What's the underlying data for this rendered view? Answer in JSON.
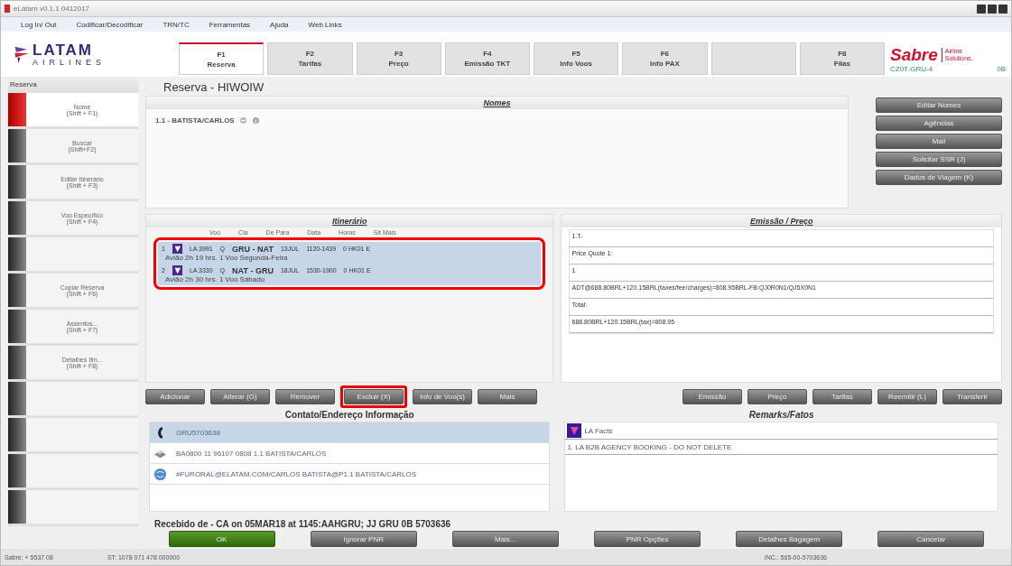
{
  "window": {
    "title": "eLatam v0.1.1 0412017"
  },
  "menu": [
    "Log In/ Out",
    "Codificar/Decodificar",
    "TRN/TC",
    "Ferramentas",
    "Ajuda",
    "Web Links"
  ],
  "logo": {
    "name": "LATAM",
    "sub": "AIRLINES"
  },
  "tabs": [
    {
      "key": "F1",
      "label": "Reserva",
      "selected": true
    },
    {
      "key": "F2",
      "label": "Tarifas",
      "selected": false
    },
    {
      "key": "F3",
      "label": "Preço",
      "selected": false
    },
    {
      "key": "F4",
      "label": "Emissão TKT",
      "selected": false
    },
    {
      "key": "F5",
      "label": "Info Voos",
      "selected": false
    },
    {
      "key": "F6",
      "label": "Info PAX",
      "selected": false
    },
    {
      "selected": false
    },
    {
      "key": "F8",
      "label": "Filas",
      "selected": false
    }
  ],
  "sabre": {
    "brand": "Sabre",
    "tagline": "Airline Solutions.",
    "code": "CZ0T-GRU-4",
    "extra": "0B"
  },
  "sidebar": {
    "title": "Reserva",
    "items": [
      {
        "label": "Nome",
        "shortcut": "(Shift + F1)",
        "selected": true
      },
      {
        "label": "Buscar",
        "shortcut": "(Shift+F2)",
        "selected": false
      },
      {
        "label": "Editar Itinerário",
        "shortcut": "(Shift + F3)",
        "selected": false
      },
      {
        "label": "Voo Específico",
        "shortcut": "(Shift + F4)",
        "selected": false
      },
      {
        "selected": false
      },
      {
        "label": "Copiar Reserva",
        "shortcut": "(Shift + F6)",
        "selected": false
      },
      {
        "label": "Assentos...",
        "shortcut": "(Shift + F7)",
        "selected": false
      },
      {
        "label": "Detalhes Itin...",
        "shortcut": "(Shift + F8)",
        "selected": false
      },
      {
        "selected": false
      },
      {
        "selected": false
      },
      {
        "selected": false
      },
      {
        "selected": false
      }
    ]
  },
  "reservation_title": "Reserva - HIWOIW",
  "names": {
    "title": "Nomes",
    "entries": [
      "1.1 - BATISTA/CARLOS"
    ]
  },
  "side_buttons": [
    "Editar Nomes",
    "Agências",
    "Mail",
    "Solicitar SSR (J)",
    "Dados de Viagem (K)"
  ],
  "itinerary": {
    "title": "Itinerário",
    "annotated": true,
    "columns": [
      "Voo",
      "Cia",
      "De Para",
      "Data",
      "Horas",
      "Sit Mais"
    ],
    "segments": [
      {
        "number": "1",
        "flight": "LA 3991",
        "class": "Q",
        "route": "GRU - NAT",
        "date": "13JUL",
        "time": "1120-1439",
        "status": "0 HK01 E",
        "detail": "Avião 2h 19 hrs. 1 Voo Segunda-Feira",
        "selected": true
      },
      {
        "number": "2",
        "flight": "LA 3330",
        "class": "Q",
        "route": "NAT - GRU",
        "date": "18JUL",
        "time": "1530-1900",
        "status": "0 HK01 E",
        "detail": "Avião 2h 30 hrs. 1 Voo Sábado",
        "selected": true
      }
    ]
  },
  "action_buttons": [
    {
      "label": "Adicionar",
      "highlighted": false
    },
    {
      "label": "Alterar (G)",
      "highlighted": false
    },
    {
      "label": "Remover",
      "highlighted": false
    },
    {
      "label": "Excluir (X)",
      "highlighted": true
    },
    {
      "label": "Info de Voo(s)",
      "highlighted": false
    },
    {
      "label": "Mais",
      "highlighted": false
    },
    {
      "label": "Emissão",
      "highlighted": false
    },
    {
      "label": "Preço",
      "highlighted": false
    },
    {
      "label": "Tarifas",
      "highlighted": false
    },
    {
      "label": "Reemitir (L)",
      "highlighted": false
    },
    {
      "label": "Transferir",
      "highlighted": false
    }
  ],
  "pricing": {
    "title": "Emissão / Preço",
    "lines": [
      "1.T-",
      "Price Quote 1:",
      "1",
      "ADT@688.80BRL+120.15BRL(taxes/fee/charges)=808.95BRL-FB:QJ0R0N1/QJ5X0N1",
      "Total:",
      "688.80BRL+120.15BRL(tax)=808.95"
    ]
  },
  "contacts": {
    "title": "Contato/Endereço Informação",
    "entries": [
      {
        "kind": "phone",
        "text": "GRU5703638",
        "selected": true
      },
      {
        "kind": "printer",
        "text": "BA0800 11 96107 0808 1.1 BATISTA/CARLOS",
        "selected": false
      },
      {
        "kind": "email",
        "text": "#FURORAL@ELATAM.COM/CARLOS BATISTA@P1.1 BATISTA/CARLOS",
        "selected": false
      }
    ]
  },
  "remarks": {
    "title": "Remarks/Fatos",
    "entries": [
      {
        "kind": "facts",
        "text": "LA Facts"
      },
      {
        "kind": "line",
        "text": "1. LA B2B AGENCY BOOKING - DO NOT DELETE"
      }
    ]
  },
  "received": "Recebido de - CA on 05MAR18 at 1145:AAHGRU; JJ GRU 0B 5703636",
  "bottom_buttons": [
    {
      "label": "OK",
      "kind": "primary"
    },
    {
      "label": "Ignorar PNR",
      "kind": "normal"
    },
    {
      "label": "Mais...",
      "kind": "normal"
    },
    {
      "label": "PNR Opções",
      "kind": "normal"
    },
    {
      "label": "Detalhes Bagagem",
      "kind": "normal"
    },
    {
      "label": "Cancelar",
      "kind": "normal"
    }
  ],
  "status_bar": [
    "Sabre: + 5537 08",
    "ST: 1078 071 478 000000",
    "INC.: 565-00-5703636"
  ]
}
